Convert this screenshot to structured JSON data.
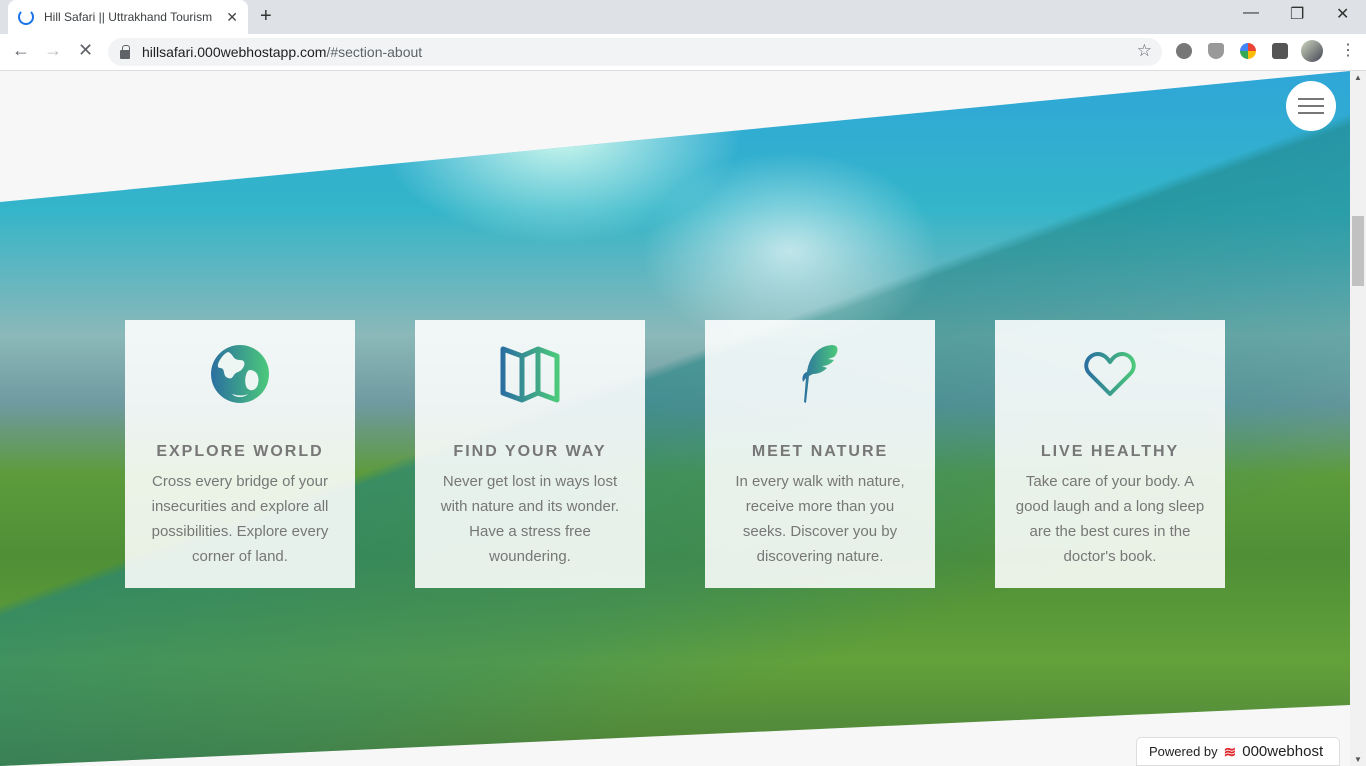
{
  "browser": {
    "tab_title": "Hill Safari || Uttrakhand Tourism",
    "url_host": "hillsafari.000webhostapp.com",
    "url_path": "/#section-about"
  },
  "colors": {
    "icon_gradient_start": "#2a6fa0",
    "icon_gradient_end": "#4cc97a"
  },
  "cards": [
    {
      "icon": "globe-icon",
      "title": "EXPLORE WORLD",
      "text": "Cross every bridge of your insecurities and explore all possibilities. Explore every corner of land."
    },
    {
      "icon": "map-icon",
      "title": "FIND YOUR WAY",
      "text": "Never get lost in ways lost with nature and its wonder. Have a stress free woundering."
    },
    {
      "icon": "feather-icon",
      "title": "MEET NATURE",
      "text": "In every walk with nature, receive more than you seeks. Discover you by discovering nature."
    },
    {
      "icon": "heart-icon",
      "title": "LIVE HEALTHY",
      "text": "Take care of your body. A good laugh and a long sleep are the best cures in the doctor's book."
    }
  ],
  "footer_badge": {
    "prefix": "Powered by",
    "brand": "000webhost"
  }
}
